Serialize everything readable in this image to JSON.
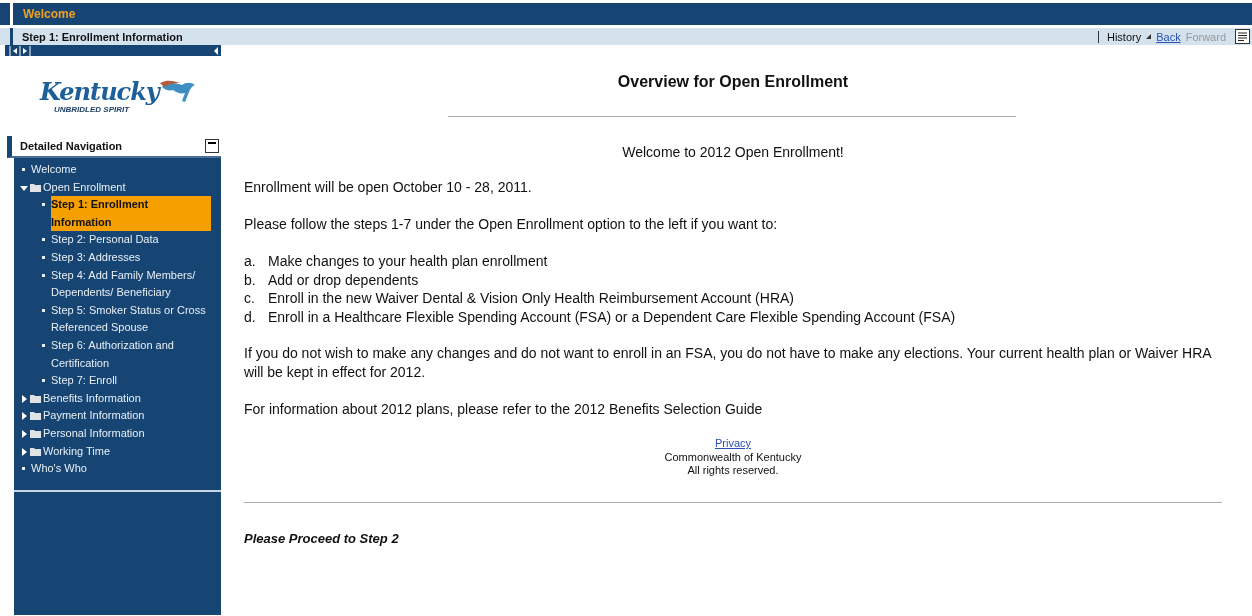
{
  "header": {
    "title": "Welcome"
  },
  "subheader": {
    "title": "Step 1: Enrollment Information",
    "history": "History",
    "back": "Back",
    "forward": "Forward",
    "forward_disabled": true
  },
  "logo": {
    "name": "Kentucky",
    "tagline": "UNBRIDLED SPIRIT"
  },
  "navigation": {
    "title": "Detailed Navigation",
    "expanded": true,
    "items": [
      {
        "kind": "leaf",
        "label": "Welcome",
        "selected": false
      },
      {
        "kind": "folder",
        "label": "Open Enrollment",
        "expanded": true,
        "selected": false,
        "children": [
          {
            "kind": "leaf",
            "label": "Step 1: Enrollment Information",
            "selected": true
          },
          {
            "kind": "leaf",
            "label": "Step 2: Personal Data",
            "selected": false
          },
          {
            "kind": "leaf",
            "label": "Step 3: Addresses",
            "selected": false
          },
          {
            "kind": "leaf",
            "label": "Step 4: Add Family Members/ Dependents/ Beneficiary",
            "selected": false
          },
          {
            "kind": "leaf",
            "label": "Step 5: Smoker Status or Cross Referenced Spouse",
            "selected": false
          },
          {
            "kind": "leaf",
            "label": "Step 6: Authorization and Certification",
            "selected": false
          },
          {
            "kind": "leaf",
            "label": "Step 7: Enroll",
            "selected": false
          }
        ]
      },
      {
        "kind": "folder",
        "label": "Benefits Information",
        "expanded": false,
        "selected": false
      },
      {
        "kind": "folder",
        "label": "Payment Information",
        "expanded": false,
        "selected": false
      },
      {
        "kind": "folder",
        "label": "Personal Information",
        "expanded": false,
        "selected": false
      },
      {
        "kind": "folder",
        "label": "Working Time",
        "expanded": false,
        "selected": false
      },
      {
        "kind": "leaf",
        "label": "Who's Who",
        "selected": false
      }
    ]
  },
  "content": {
    "title": "Overview for Open Enrollment",
    "welcome": "Welcome to 2012 Open Enrollment!",
    "open_dates": "Enrollment will be open October 10 - 28, 2011.",
    "instructions": "Please follow the steps 1-7 under the Open Enrollment option to the left if you want to:",
    "options": [
      {
        "letter": "a.",
        "text": "Make changes to your health plan enrollment"
      },
      {
        "letter": "b.",
        "text": "Add or drop dependents"
      },
      {
        "letter": "c.",
        "text": "Enroll in the new Waiver Dental & Vision Only Health Reimbursement Account (HRA)"
      },
      {
        "letter": "d.",
        "text": "Enroll in a Healthcare Flexible Spending Account (FSA) or a Dependent Care Flexible Spending Account (FSA)"
      }
    ],
    "no_changes": "If you do not wish to make any changes and do not want to enroll in an FSA, you do not have to make any elections. Your current health plan or Waiver HRA will be kept in effect for 2012.",
    "plans_info": "For information about 2012 plans, please refer to the 2012 Benefits Selection Guide",
    "footer": {
      "privacy": "Privacy",
      "owner": "Commonwealth of Kentucky",
      "rights": "All rights reserved."
    },
    "proceed": "Please Proceed to Step 2"
  }
}
